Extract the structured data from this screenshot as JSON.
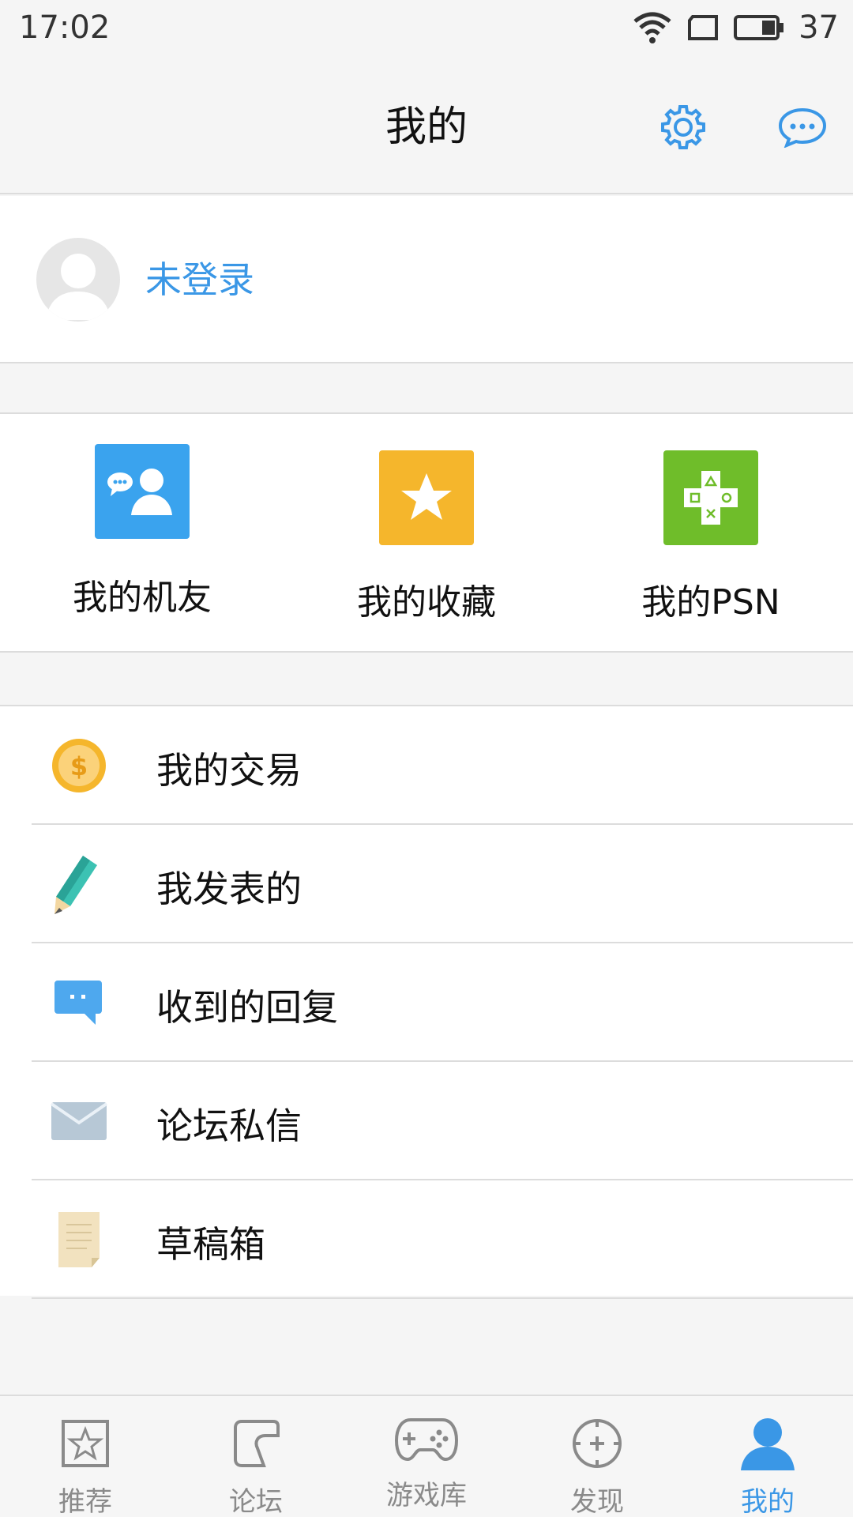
{
  "status": {
    "time": "17:02",
    "battery": "37"
  },
  "header": {
    "title": "我的"
  },
  "profile": {
    "login_text": "未登录"
  },
  "grid": [
    {
      "label": "我的机友",
      "color": "#3aa3ee"
    },
    {
      "label": "我的收藏",
      "color": "#f5b62c"
    },
    {
      "label": "我的PSN",
      "color": "#6fbd2a"
    }
  ],
  "list": [
    {
      "label": "我的交易"
    },
    {
      "label": "我发表的"
    },
    {
      "label": "收到的回复"
    },
    {
      "label": "论坛私信"
    },
    {
      "label": "草稿箱"
    }
  ],
  "nav": [
    {
      "label": "推荐"
    },
    {
      "label": "论坛"
    },
    {
      "label": "游戏库"
    },
    {
      "label": "发现"
    },
    {
      "label": "我的"
    }
  ],
  "colors": {
    "accent": "#3a97e6",
    "border": "#dcdcdc",
    "bg": "#f5f5f5"
  }
}
